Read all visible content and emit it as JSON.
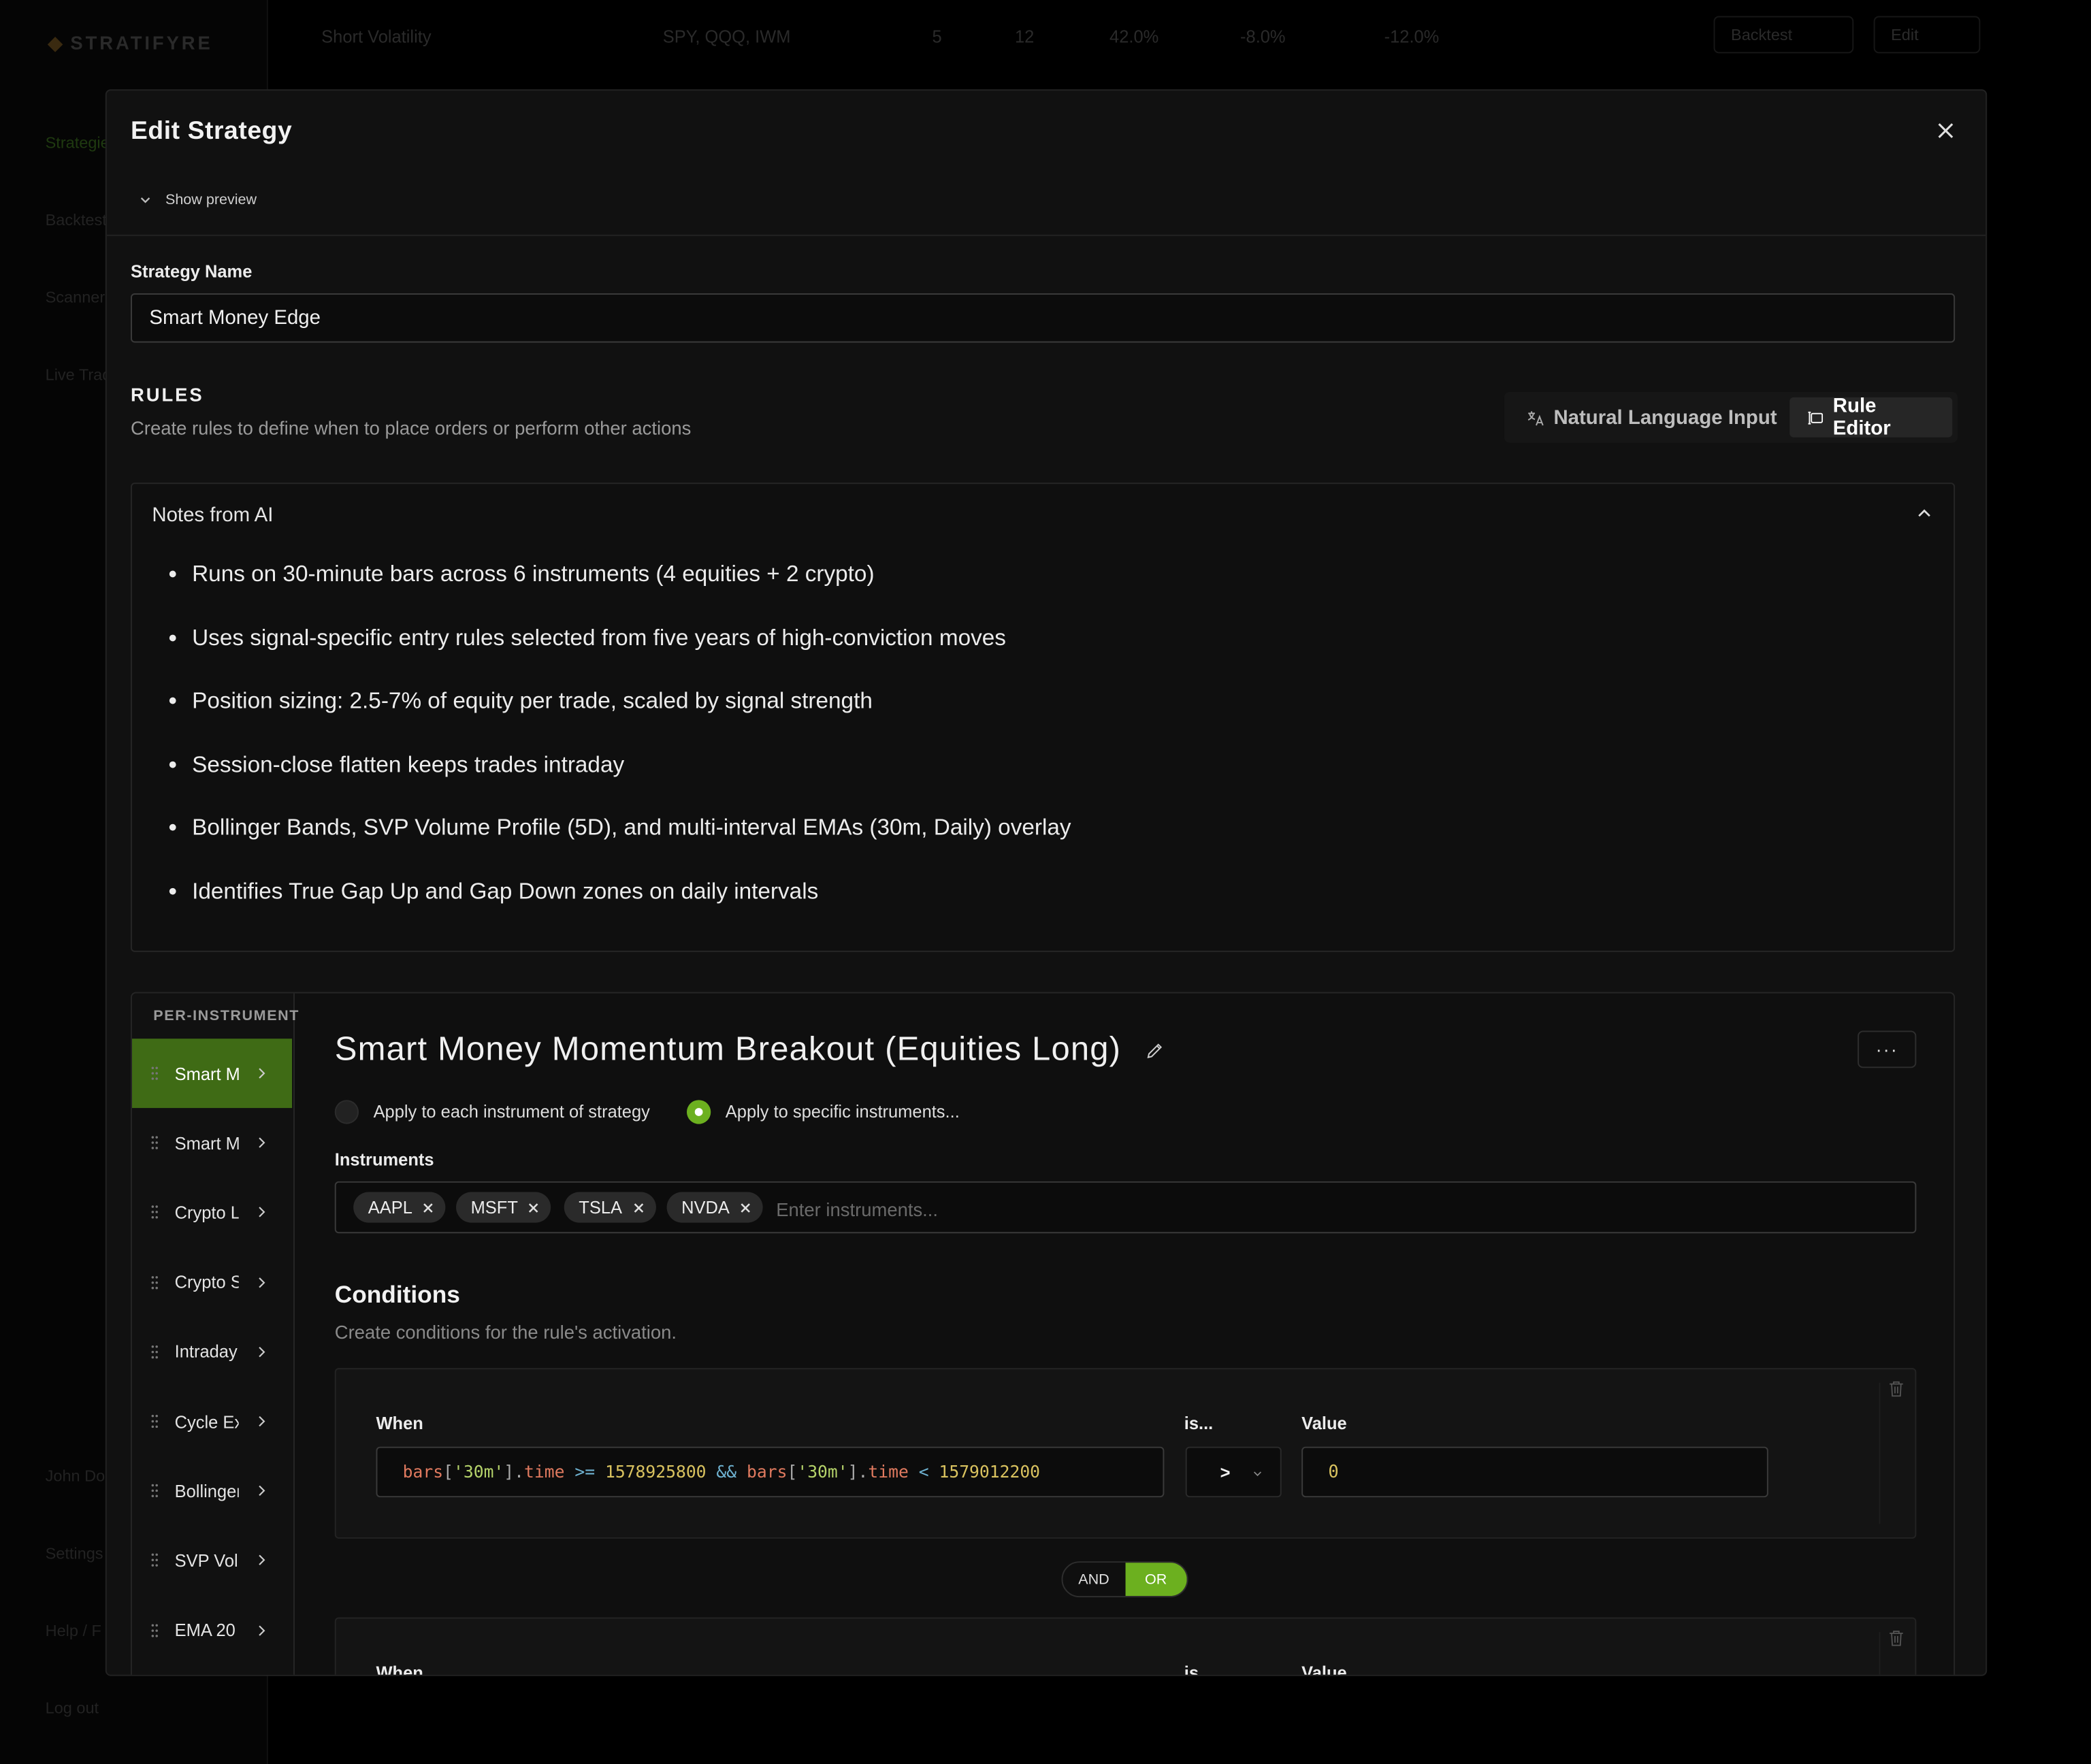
{
  "background": {
    "logo": "STRATIFYRE",
    "nav": [
      "Strategies",
      "Backtest",
      "Scanner",
      "Live Trading",
      "John Do",
      "Settings",
      "Help / F",
      "Log out"
    ],
    "row": {
      "name": "Short Volatility",
      "instruments": "SPY, QQQ, IWM",
      "col1": "5",
      "col2": "12",
      "col3": "42.0%",
      "col4": "-8.0%",
      "col5": "-12.0%",
      "backtest_label": "Backtest",
      "edit_label": "Edit"
    }
  },
  "modal": {
    "title": "Edit Strategy",
    "show_preview": "Show preview",
    "strategy_name_label": "Strategy Name",
    "strategy_name_value": "Smart Money Edge"
  },
  "rules": {
    "heading": "RULES",
    "subtitle": "Create rules to define when to place orders or perform other actions",
    "tab_nl": "Natural Language Input",
    "tab_editor": "Rule Editor"
  },
  "notes": {
    "title": "Notes from AI",
    "items": [
      "Runs on 30-minute bars across 6 instruments (4 equities + 2 crypto)",
      "Uses signal-specific entry rules selected from five years of high-conviction moves",
      "Position sizing: 2.5-7% of equity per trade, scaled by signal strength",
      "Session-close flatten keeps trades intraday",
      "Bollinger Bands, SVP Volume Profile (5D), and multi-interval EMAs (30m, Daily) overlay",
      "Identifies True Gap Up and Gap Down zones on daily intervals"
    ]
  },
  "rule_list": {
    "header": "PER-INSTRUMENT",
    "items": [
      "Smart Money Momentum Breakout (Equities Long)",
      "Smart Money",
      "Crypto Long",
      "Crypto Short",
      "Intraday",
      "Cycle Exit",
      "Bollinger",
      "SVP Volume",
      "EMA 20"
    ]
  },
  "rule": {
    "title": "Smart Money Momentum Breakout (Equities Long)",
    "more": "···",
    "apply_each": "Apply to each instrument of strategy",
    "apply_specific": "Apply to specific instruments...",
    "instruments_label": "Instruments",
    "instruments": [
      "AAPL",
      "MSFT",
      "TSLA",
      "NVDA"
    ],
    "instruments_placeholder": "Enter instruments...",
    "conditions_title": "Conditions",
    "conditions_subtitle": "Create conditions for the rule's activation.",
    "when_label": "When",
    "is_label": "is...",
    "value_label": "Value",
    "condition_1": {
      "operator": ">",
      "value": "0"
    },
    "and": "AND",
    "or": "OR"
  },
  "colors": {
    "accent": "#6cb01f",
    "active_item": "#3f6b15",
    "modal_bg": "#111111"
  }
}
